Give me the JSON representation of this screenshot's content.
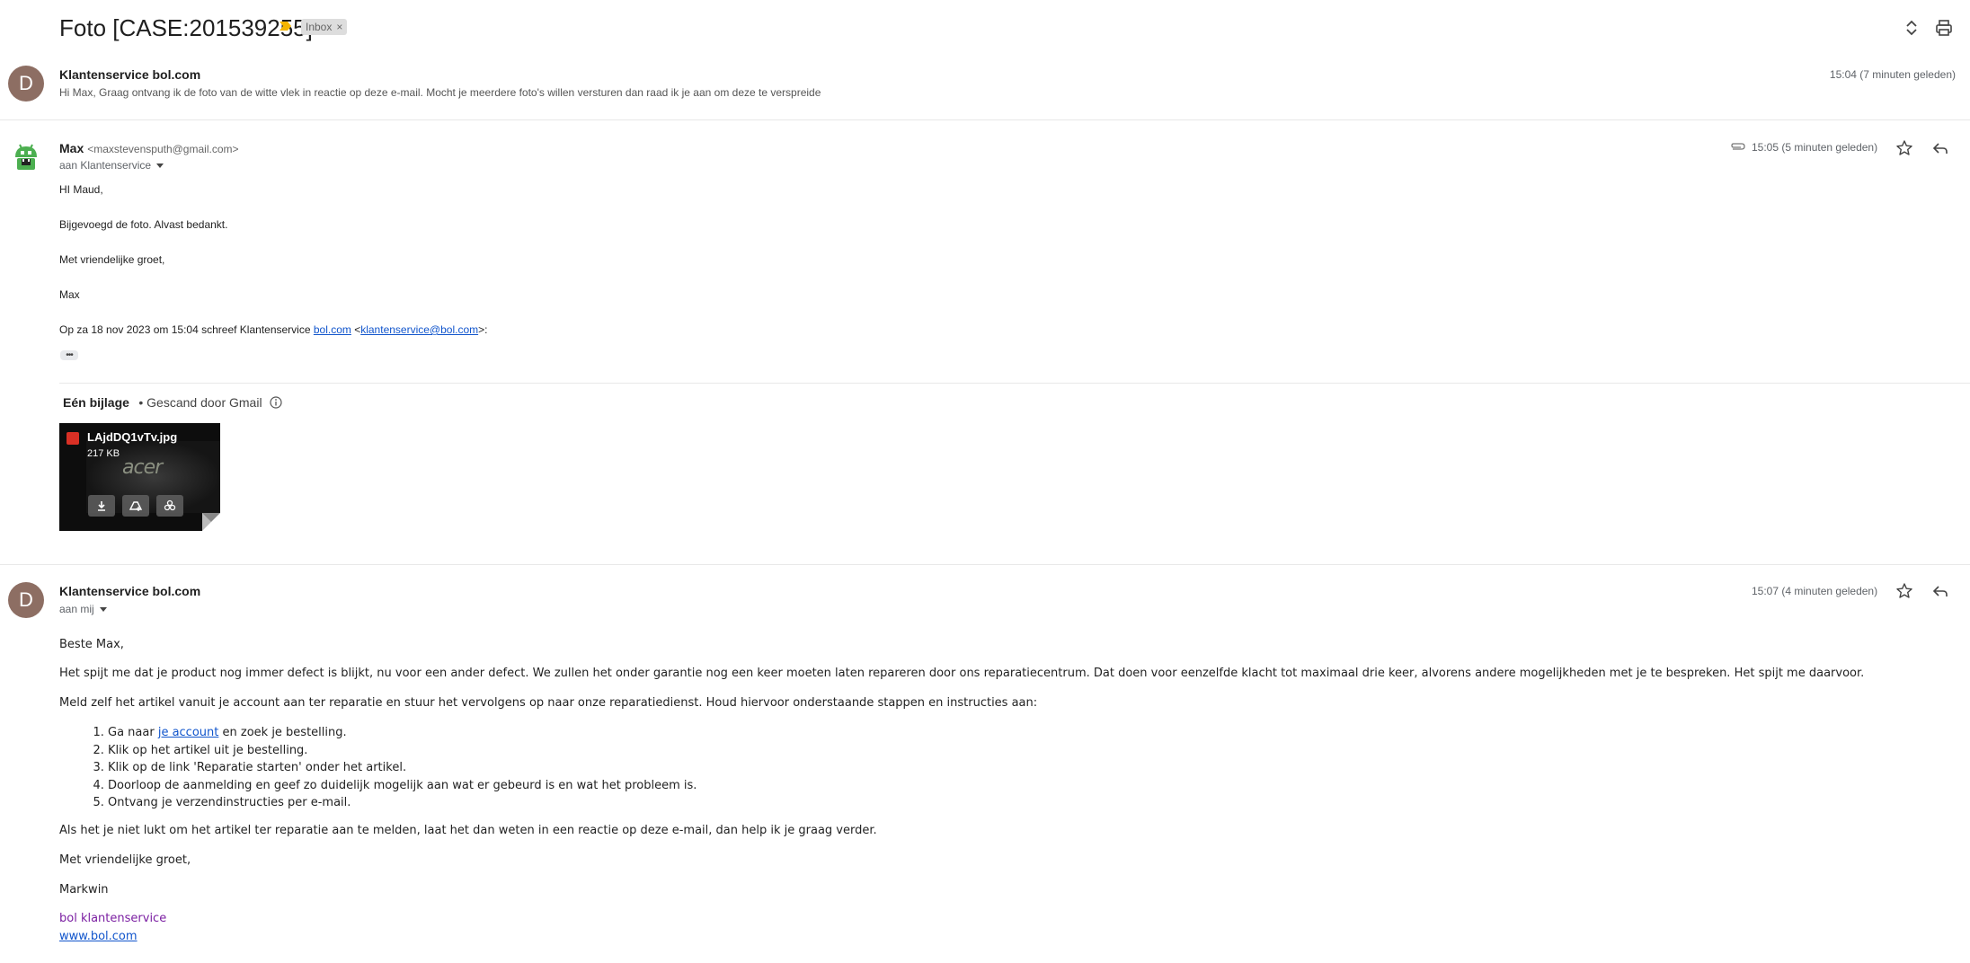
{
  "thread": {
    "subject": "Foto [CASE:201539255]",
    "label": "Inbox",
    "label_remove": "×",
    "colors": {
      "important": "#f4b400",
      "avatar_d": "#8d6e63",
      "link": "#1155cc",
      "signature": "#7b1fa2"
    }
  },
  "messages": [
    {
      "avatar_letter": "D",
      "sender": "Klantenservice bol.com",
      "snippet": "Hi Max, Graag ontvang ik de foto van de witte vlek in reactie op deze e-mail. Mocht je meerdere foto's willen versturen dan raad ik je aan om deze te verspreide",
      "time": "15:04 (7 minuten geleden)"
    },
    {
      "sender": "Max",
      "email": "<maxstevensputh@gmail.com>",
      "to": "aan Klantenservice",
      "time": "15:05 (5 minuten geleden)",
      "body": [
        "HI Maud,",
        "Bijgevoegd de foto. Alvast bedankt.",
        "Met vriendelijke groet,",
        "Max"
      ],
      "quote_prefix": "Op za 18 nov 2023 om 15:04 schreef Klantenservice ",
      "quote_link1": "bol.com",
      "quote_mid": " <",
      "quote_link2": "klantenservice@bol.com",
      "quote_suffix": ">:",
      "dots": "•••",
      "attachments": {
        "title": "Eén bijlage",
        "meta": "• Gescand door Gmail",
        "file_name": "LAjdDQ1vTv.jpg",
        "file_size": "217 KB",
        "image_text": "acer"
      }
    },
    {
      "avatar_letter": "D",
      "sender": "Klantenservice bol.com",
      "to": "aan mij",
      "time": "15:07 (4 minuten geleden)",
      "greeting": "Beste Max,",
      "p1": "Het spijt me dat je product nog immer defect is blijkt, nu voor een ander defect. We zullen het onder garantie nog een keer moeten laten repareren door ons reparatiecentrum. Dat doen voor eenzelfde klacht tot maximaal drie keer, alvorens andere mogelijkheden met je te bespreken. Het spijt me daarvoor.",
      "p2": "Meld zelf het artikel vanuit je account aan ter reparatie en stuur het vervolgens op naar onze reparatiedienst. Houd hiervoor onderstaande stappen en instructies aan:",
      "step1_prefix": "Ga naar ",
      "step1_link": "je account",
      "step1_suffix": " en zoek je bestelling.",
      "steps": [
        "Klik op het artikel uit je bestelling.",
        "Klik op de link 'Reparatie starten' onder het artikel.",
        "Doorloop de aanmelding en geef zo duidelijk mogelijk aan wat er gebeurd is en wat het probleem is.",
        "Ontvang je verzendinstructies per e-mail."
      ],
      "p3": "Als het je niet lukt om het artikel ter reparatie aan te melden, laat het dan weten in een reactie op deze e-mail, dan help ik je graag verder.",
      "closing": "Met vriendelijke groet,",
      "name": "Markwin",
      "sig": "bol klantenservice",
      "sig_link": "www.bol.com"
    }
  ]
}
